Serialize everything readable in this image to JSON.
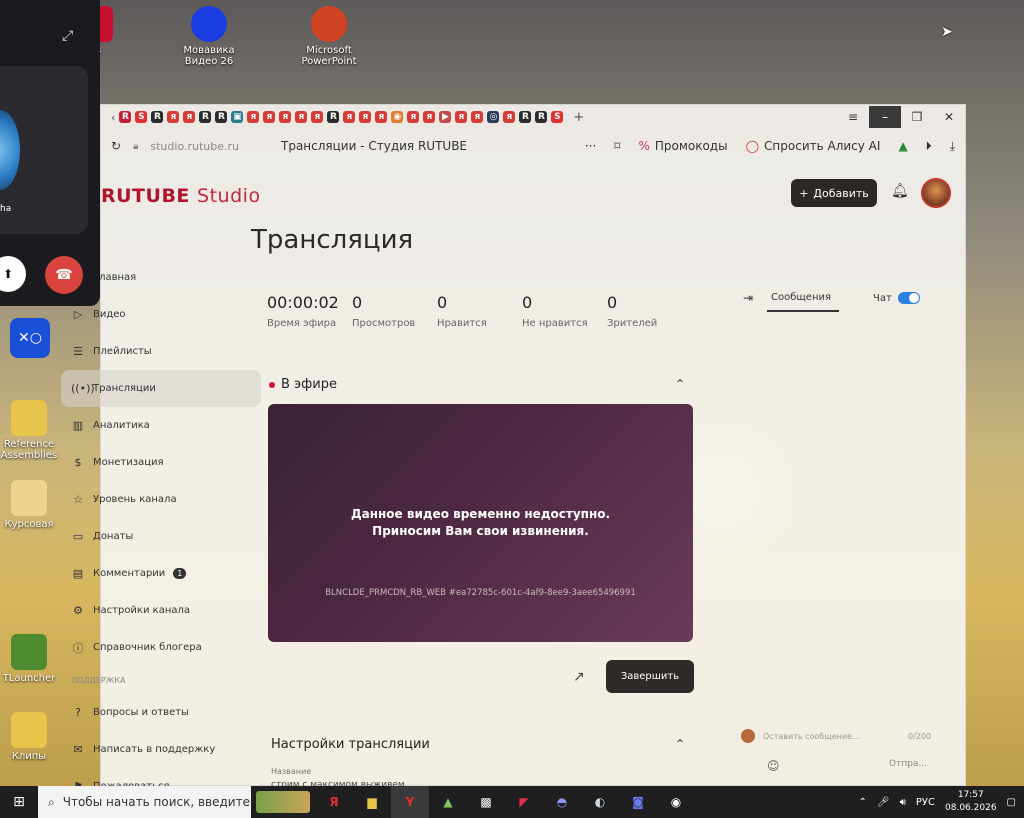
{
  "desktop": {
    "icons": [
      {
        "label": "Us"
      },
      {
        "label": "Мовавика Видео 26"
      },
      {
        "label": "Microsoft PowerPoint"
      },
      {
        "label": "Reference Assemblies"
      },
      {
        "label": "Курсовая"
      },
      {
        "label": "TLauncher"
      },
      {
        "label": "Клипы"
      }
    ]
  },
  "browser": {
    "url": "studio.rutube.ru",
    "page_title": "Трансляции - Студия RUTUBE",
    "promo_label": "Промокоды",
    "alice_label": "Спросить Алису AI"
  },
  "studio": {
    "logo_main": "RUTUBE",
    "logo_sub": "Studio",
    "add_label": "Добавить",
    "heading": "Трансляция",
    "sidebar": [
      {
        "label": "Главная",
        "icon": "home-icon"
      },
      {
        "label": "Видео",
        "icon": "video-icon"
      },
      {
        "label": "Плейлисты",
        "icon": "playlist-icon"
      },
      {
        "label": "Трансляции",
        "icon": "broadcast-icon"
      },
      {
        "label": "Аналитика",
        "icon": "analytics-icon"
      },
      {
        "label": "Монетизация",
        "icon": "money-icon"
      },
      {
        "label": "Уровень канала",
        "icon": "star-icon"
      },
      {
        "label": "Донаты",
        "icon": "donate-icon"
      },
      {
        "label": "Комментарии",
        "icon": "comment-icon",
        "badge": "1"
      },
      {
        "label": "Настройки канала",
        "icon": "gear-icon"
      },
      {
        "label": "Справочник блогера",
        "icon": "info-icon"
      },
      {
        "label": "ПОДДЕРЖКА",
        "icon": ""
      },
      {
        "label": "Вопросы и ответы",
        "icon": "question-icon"
      },
      {
        "label": "Написать в поддержку",
        "icon": "mail-icon"
      },
      {
        "label": "Пожаловаться",
        "icon": "flag-icon"
      }
    ],
    "stats": [
      {
        "value": "00:00:02",
        "label": "Время эфира"
      },
      {
        "value": "0",
        "label": "Просмотров"
      },
      {
        "value": "0",
        "label": "Нравится"
      },
      {
        "value": "0",
        "label": "Не нравится"
      },
      {
        "value": "0",
        "label": "Зрителей"
      }
    ],
    "live_label": "В эфире",
    "player": {
      "message_line1": "Данное видео временно недоступно.",
      "message_line2": "Приносим Вам свои извинения.",
      "code": "BLNCLDE_PRMCDN_RB_WEB #ea72785c-601c-4af9-8ee9-3aee65496991"
    },
    "end_label": "Завершить",
    "settings_heading": "Настройки трансляции",
    "name_label": "Название",
    "name_value": "стрим с максимом выживем",
    "chat": {
      "messages_tab": "Сообщения",
      "chat_label": "Чат",
      "input_placeholder": "Оставить сообщение...",
      "counter": "0/200",
      "send_label": "Отпра..."
    }
  },
  "call": {
    "name": "ha"
  },
  "taskbar": {
    "search_placeholder": "Чтобы начать поиск, введите",
    "lang": "РУС",
    "time": "17:57",
    "date": "08.06.2026"
  },
  "colors": {
    "brand": "#b0142d",
    "toggle": "#2a7de1",
    "live_dot": "#d4102f"
  }
}
